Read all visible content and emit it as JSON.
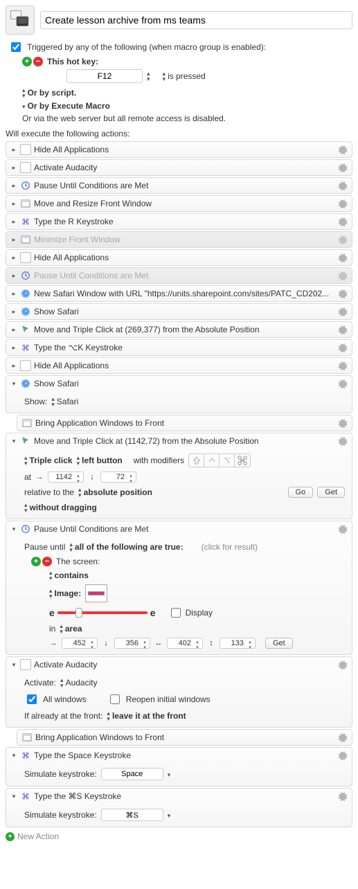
{
  "title": "Create lesson archive from ms teams",
  "trigger": {
    "label": "Triggered by any of the following (when macro group is enabled):",
    "hotkey_label": "This hot key:",
    "hotkey_value": "F12",
    "hotkey_state": "is pressed",
    "or_script": "Or by script.",
    "or_execute": "Or by Execute Macro",
    "or_web": "Or via the web server but all remote access is disabled."
  },
  "exec_label": "Will execute the following actions:",
  "actions": [
    {
      "t": "Hide All Applications",
      "icon": "app"
    },
    {
      "t": "Activate Audacity",
      "icon": "app"
    },
    {
      "t": "Pause Until Conditions are Met",
      "icon": "clock"
    },
    {
      "t": "Move and Resize Front Window",
      "icon": "window"
    },
    {
      "t": "Type the R Keystroke",
      "icon": "cmd"
    },
    {
      "t": "Minimize Front Window",
      "icon": "window",
      "disabled": true
    },
    {
      "t": "Hide All Applications",
      "icon": "app"
    },
    {
      "t": "Pause Until Conditions are Met",
      "icon": "clock",
      "disabled": true
    },
    {
      "t": "New Safari Window with URL \"https://units.sharepoint.com/sites/PATC_CD202...",
      "icon": "safari"
    },
    {
      "t": "Show Safari",
      "icon": "safari"
    },
    {
      "t": "Move and Triple Click at (269,377) from the Absolute Position",
      "icon": "cursor"
    },
    {
      "t": "Type the ⌥K Keystroke",
      "icon": "cmd"
    },
    {
      "t": "Hide All Applications",
      "icon": "app"
    }
  ],
  "show_safari": {
    "title": "Show Safari",
    "show_label": "Show:",
    "show_value": "Safari",
    "sub_title": "Bring Application Windows to Front"
  },
  "triple_click": {
    "title": "Move and Triple Click at (1142,72) from the Absolute Position",
    "mode": "Triple click",
    "button": "left button",
    "with_mod": "with modifiers",
    "at_label": "at",
    "x": "1142",
    "y": "72",
    "rel_label": "relative to the",
    "rel_value": "absolute position",
    "go": "Go",
    "get": "Get",
    "drag": "without dragging"
  },
  "pause_cond": {
    "title": "Pause Until Conditions are Met",
    "pause_until": "Pause until",
    "all_true": "all of the following are true:",
    "click_result": "(click for result)",
    "screen_label": "The screen:",
    "contains": "contains",
    "image_label": "Image:",
    "display_label": "Display",
    "in_label": "in",
    "area_label": "area",
    "x": "452",
    "y": "356",
    "w": "402",
    "h": "133",
    "get": "Get"
  },
  "activate_aud": {
    "title": "Activate Audacity",
    "activate_label": "Activate:",
    "activate_value": "Audacity",
    "all_windows": "All windows",
    "reopen": "Reopen initial windows",
    "already_label": "If already at the front:",
    "already_value": "leave it at the front",
    "sub_title": "Bring Application Windows to Front"
  },
  "type_space": {
    "title": "Type the Space Keystroke",
    "sim_label": "Simulate keystroke:",
    "sim_value": "Space"
  },
  "type_cmds": {
    "title": "Type the ⌘S Keystroke",
    "sim_label": "Simulate keystroke:",
    "sim_value": "⌘S"
  },
  "new_action": "New Action"
}
